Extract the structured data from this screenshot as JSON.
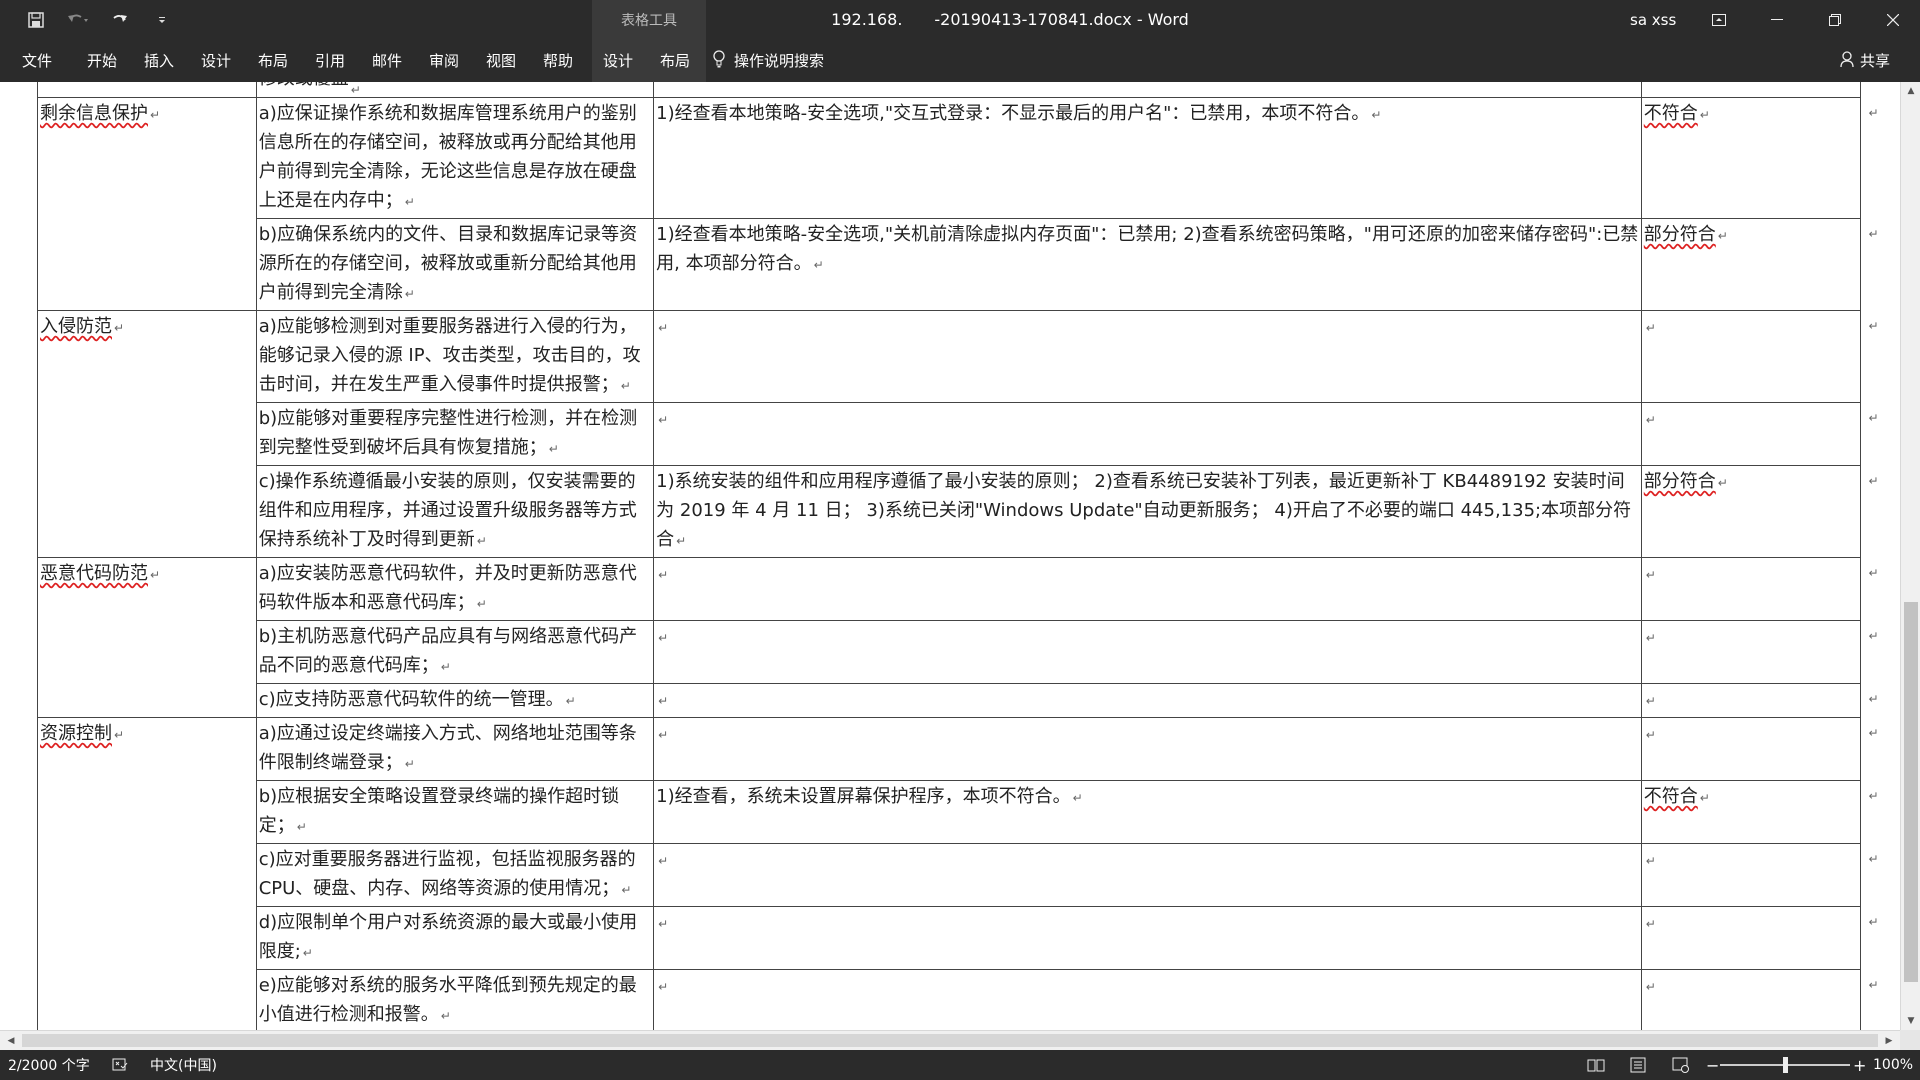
{
  "title_bar": {
    "context_tab_group": "表格工具",
    "document_title": "192.168.  -20190413-170841.docx  -  Word",
    "user": "sa xss"
  },
  "ribbon": {
    "tabs": [
      "文件",
      "开始",
      "插入",
      "设计",
      "布局",
      "引用",
      "邮件",
      "审阅",
      "视图",
      "帮助",
      "设计",
      "布局"
    ],
    "tell_me": "操作说明搜索",
    "share": "共享"
  },
  "table": {
    "top_fragment": "修改或覆盖",
    "rows": [
      {
        "category": "剩余信息保护",
        "requirement": "a)应保证操作系统和数据库管理系统用户的鉴别信息所在的存储空间，被释放或再分配给其他用户前得到完全清除，无论这些信息是存放在硬盘上还是在内存中；",
        "finding": "1)经查看本地策略-安全选项,\"交互式登录：不显示最后的用户名\"：已禁用，本项不符合。",
        "result": "不符合"
      },
      {
        "category": "",
        "requirement": "b)应确保系统内的文件、目录和数据库记录等资源所在的存储空间，被释放或重新分配给其他用户前得到完全清除",
        "finding": "1)经查看本地策略-安全选项,\"关机前清除虚拟内存页面\"：已禁用; 2)查看系统密码策略，\"用可还原的加密来储存密码\":已禁用, 本项部分符合。",
        "result": "部分符合"
      },
      {
        "category": "入侵防范",
        "requirement": "a)应能够检测到对重要服务器进行入侵的行为，能够记录入侵的源 IP、攻击类型，攻击目的，攻击时间，并在发生严重入侵事件时提供报警；",
        "finding": "",
        "result": ""
      },
      {
        "category": "",
        "requirement": "b)应能够对重要程序完整性进行检测，并在检测到完整性受到破坏后具有恢复措施；",
        "finding": "",
        "result": ""
      },
      {
        "category": "",
        "requirement": "c)操作系统遵循最小安装的原则，仅安装需要的组件和应用程序，并通过设置升级服务器等方式保持系统补丁及时得到更新",
        "finding": "1)系统安装的组件和应用程序遵循了最小安装的原则； 2)查看系统已安装补丁列表，最近更新补丁 KB4489192 安装时间为 2019 年 4 月 11 日； 3)系统已关闭\"Windows Update\"自动更新服务； 4)开启了不必要的端口 445,135;本项部分符合",
        "result": "部分符合"
      },
      {
        "category": "恶意代码防范",
        "requirement": "a)应安装防恶意代码软件，并及时更新防恶意代码软件版本和恶意代码库；",
        "finding": "",
        "result": ""
      },
      {
        "category": "",
        "requirement": "b)主机防恶意代码产品应具有与网络恶意代码产品不同的恶意代码库；",
        "finding": "",
        "result": ""
      },
      {
        "category": "",
        "requirement": "c)应支持防恶意代码软件的统一管理。",
        "finding": "",
        "result": ""
      },
      {
        "category": "资源控制",
        "requirement": "a)应通过设定终端接入方式、网络地址范围等条件限制终端登录；",
        "finding": "",
        "result": ""
      },
      {
        "category": "",
        "requirement": "b)应根据安全策略设置登录终端的操作超时锁定；",
        "finding": "1)经查看，系统未设置屏幕保护程序，本项不符合。",
        "result": "不符合"
      },
      {
        "category": "",
        "requirement": "c)应对重要服务器进行监视，包括监视服务器的 CPU、硬盘、内存、网络等资源的使用情况；",
        "finding": "",
        "result": ""
      },
      {
        "category": "",
        "requirement": "d)应限制单个用户对系统资源的最大或最小使用限度;",
        "finding": "",
        "result": ""
      },
      {
        "category": "",
        "requirement": "e)应能够对系统的服务水平降低到预先规定的最小值进行检测和报警。",
        "finding": "",
        "result": ""
      }
    ]
  },
  "status_bar": {
    "word_count": "2/2000 个字",
    "language": "中文(中国)",
    "zoom": "100%",
    "zoom_fraction": 0.5
  }
}
